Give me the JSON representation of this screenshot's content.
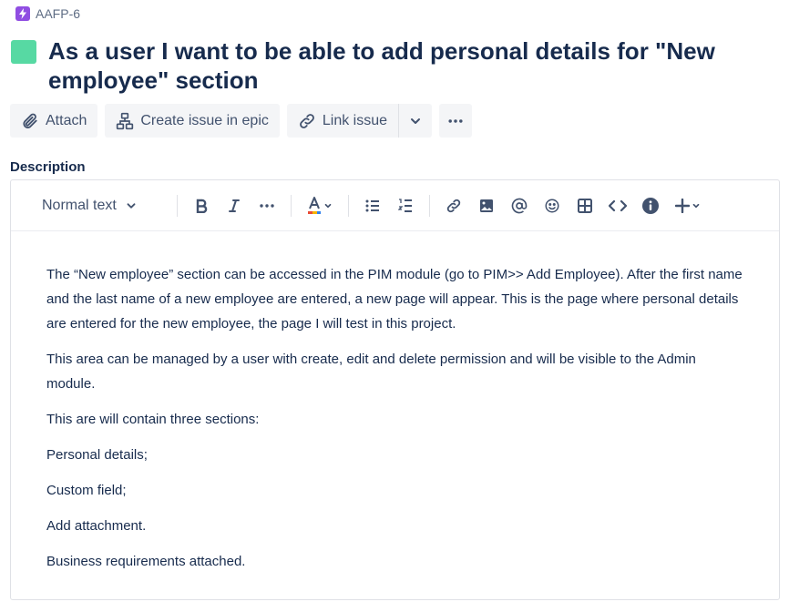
{
  "breadcrumb": {
    "key": "AAFP-6",
    "icon": "epic-lightning-icon"
  },
  "issue": {
    "title": "As a user I want to be able to add personal details for \"New employee\" section",
    "type_color": "#57d9a3"
  },
  "actions": {
    "attach": "Attach",
    "create_in_epic": "Create issue in epic",
    "link_issue": "Link issue"
  },
  "description": {
    "label": "Description",
    "toolbar": {
      "text_style": "Normal text",
      "buttons": [
        "bold-icon",
        "italic-icon",
        "more-formatting-icon",
        "text-color-icon",
        "bullet-list-icon",
        "numbered-list-icon",
        "link-icon",
        "image-icon",
        "mention-icon",
        "emoji-icon",
        "table-icon",
        "code-icon",
        "info-panel-icon",
        "insert-plus-icon"
      ]
    },
    "paragraphs": [
      "The “New employee” section can be accessed in the PIM module (go to PIM>> Add Employee). After the first name and the last name of a new employee are entered, a new page will appear. This is the page where personal details are entered for the new employee, the page I will test in this project.",
      "This area can be managed by a user with create, edit and delete permission and  will be visible  to the Admin module.",
      "This are will contain three sections:",
      "Personal details;",
      "Custom field;",
      "Add attachment.",
      "Business requirements attached."
    ]
  },
  "colors": {
    "epic": "#904ee2",
    "text": "#172b4d",
    "subtle": "#42526e",
    "button_bg": "#f4f5f7"
  }
}
